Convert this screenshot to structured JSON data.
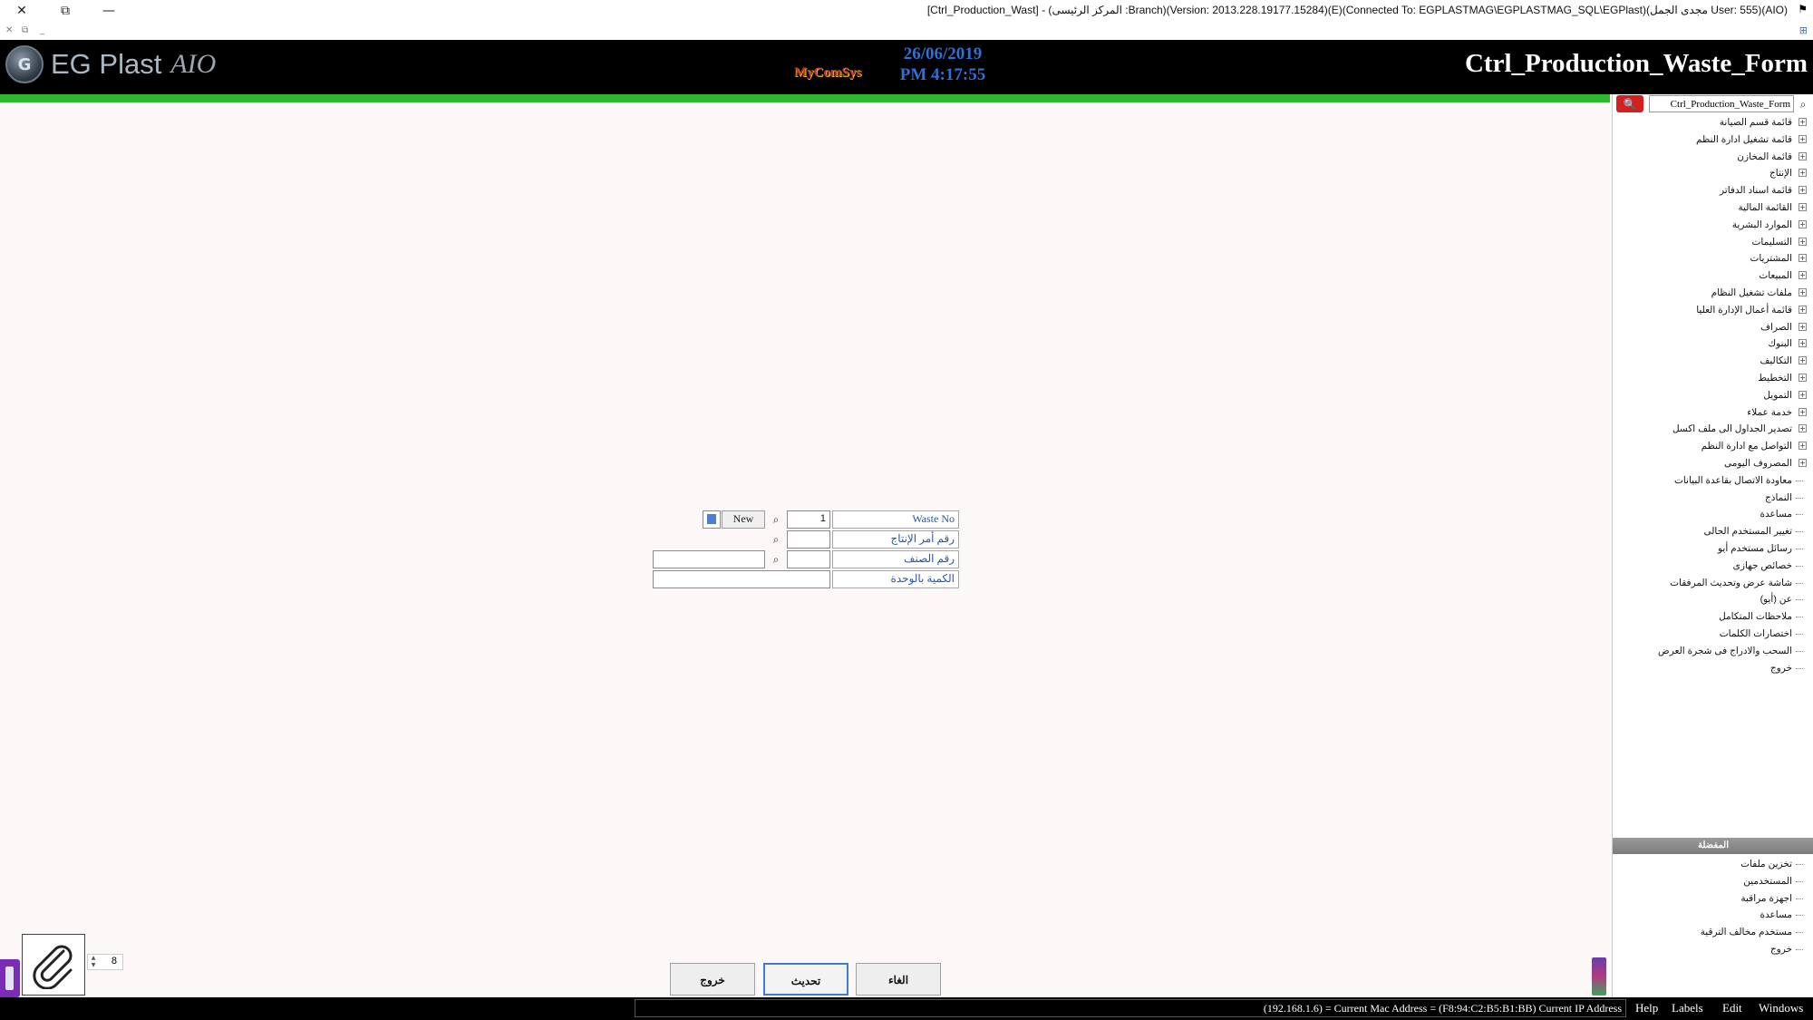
{
  "window": {
    "title": "[Ctrl_Production_Wast] - (المركز الرئيسى :Branch)(Version: 2013.228.19177.15284)(E)(Connected To: EGPLASTMAG\\EGPLASTMAG_SQL\\EGPlast)(مجدى الجمل User: 555)(AIO)",
    "close_glyph": "✕",
    "restore_glyph": "⧉",
    "minimize_glyph": "—",
    "flag_glyph": "⚑",
    "sub_close": "✕",
    "sub_restore": "⧉",
    "sub_min": "_",
    "sub_right": "⊞"
  },
  "header": {
    "logo_emblem": "G",
    "logo_text": "EG Plast",
    "logo_aio": "AIO",
    "mycomsys": "MyComSys",
    "date": "26/06/2019",
    "time": "PM 4:17:55",
    "form_title": "Ctrl_Production_Waste_Form"
  },
  "search": {
    "value": "Ctrl_Production_Waste_Form",
    "button_glyph": "🔍",
    "icon_glyph": "⌕"
  },
  "tree": [
    {
      "label": "قائمة قسم الصيانة",
      "expand": "+"
    },
    {
      "label": "قائمة تشغيل ادارة النظم",
      "expand": "+"
    },
    {
      "label": "قائمة المخازن",
      "expand": "+"
    },
    {
      "label": "الإنتاج",
      "expand": "+"
    },
    {
      "label": "قائمة اسناد الدفاتر",
      "expand": "+"
    },
    {
      "label": "القائمة المالية",
      "expand": "+"
    },
    {
      "label": "الموارد البشرية",
      "expand": "+"
    },
    {
      "label": "التسليمات",
      "expand": "+"
    },
    {
      "label": "المشتريات",
      "expand": "+"
    },
    {
      "label": "المبيعات",
      "expand": "+"
    },
    {
      "label": "ملفات تشغيل النظام",
      "expand": "+"
    },
    {
      "label": "قائمة أعمال الإدارة العليا",
      "expand": "+"
    },
    {
      "label": "الصراف",
      "expand": "+"
    },
    {
      "label": "البنوك",
      "expand": "+"
    },
    {
      "label": "التكاليف",
      "expand": "+"
    },
    {
      "label": "التخطيط",
      "expand": "+"
    },
    {
      "label": "التمويل",
      "expand": "+"
    },
    {
      "label": "خدمة عملاء",
      "expand": "+"
    },
    {
      "label": "تصدير الجداول الى ملف اكسل",
      "expand": "+"
    },
    {
      "label": "التواصل مع ادارة النظم",
      "expand": "+"
    },
    {
      "label": "المصروف اليومى",
      "expand": "+"
    },
    {
      "label": "معاودة الاتصال بقاعدة البيانات",
      "expand": ""
    },
    {
      "label": "النماذج",
      "expand": ""
    },
    {
      "label": "مساعدة",
      "expand": ""
    },
    {
      "label": "تغيير المستخدم الحالى",
      "expand": ""
    },
    {
      "label": "رسائل مستخدم أيو",
      "expand": ""
    },
    {
      "label": "خصائص جهازى",
      "expand": ""
    },
    {
      "label": "شاشة عرض وتحديث المرفقات",
      "expand": ""
    },
    {
      "label": "عن (أيو)",
      "expand": ""
    },
    {
      "label": "ملاحظات المتكامل",
      "expand": ""
    },
    {
      "label": "اختصارات الكلمات",
      "expand": ""
    },
    {
      "label": "السحب والادراج فى شجرة العرض",
      "expand": ""
    },
    {
      "label": "خروج",
      "expand": ""
    }
  ],
  "favorites": {
    "header": "المفضلة",
    "items": [
      "تخزين ملفات",
      "المستخدمين",
      "اجهزة مراقبة",
      "مساعدة",
      "مستخدم مخالف الترقية",
      "خروج"
    ]
  },
  "form": {
    "waste_no_label": "Waste No",
    "waste_no_value": "1",
    "new_label": "New",
    "production_order_label": "رقم أمر الإنتاج",
    "item_no_label": "رقم الصنف",
    "qty_label": "الكمية بالوحدة",
    "lookup_glyph": "⌕"
  },
  "buttons": {
    "cancel": "الغاء",
    "update": "تحديث",
    "exit": "خروج"
  },
  "attachments": {
    "count": "8",
    "up": "▲",
    "down": "▼"
  },
  "status": {
    "network": "(192.168.1.6) = Current Mac Address = (F8:94:C2:B5:B1:BB) Current IP Address",
    "menu": [
      "Help",
      "Labels",
      "Edit",
      "Windows"
    ]
  }
}
